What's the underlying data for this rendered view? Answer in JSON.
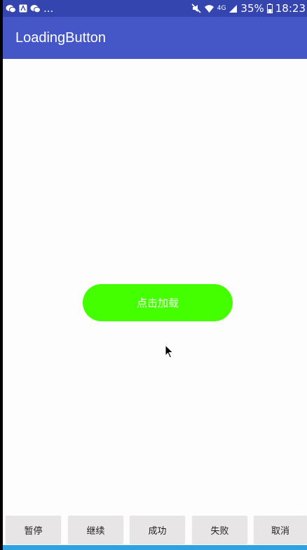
{
  "status_bar": {
    "overflow": "...",
    "network": "4G",
    "battery": "35%",
    "time": "18:23"
  },
  "app_bar": {
    "title": "LoadingButton"
  },
  "main": {
    "load_button_label": "点击加载"
  },
  "controls": [
    {
      "label": "暂停"
    },
    {
      "label": "继续"
    },
    {
      "label": "成功"
    },
    {
      "label": "失败"
    },
    {
      "label": "取消"
    }
  ],
  "colors": {
    "status_bar": "#3545b0",
    "app_bar": "#4557c6",
    "load_button": "#44ff00",
    "bottom_strip": "#2ea3e0"
  }
}
